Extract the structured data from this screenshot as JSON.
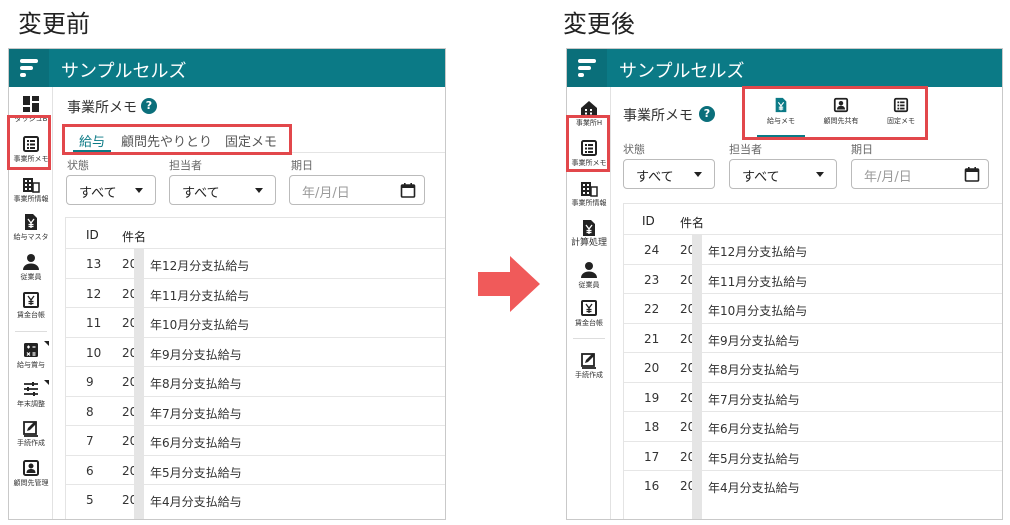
{
  "captions": {
    "before": "変更前",
    "after": "変更後"
  },
  "app": {
    "title": "サンプルセルズ"
  },
  "before": {
    "sidebar": [
      {
        "label": "ダッシュB",
        "icon": "dashboard-icon"
      },
      {
        "label": "事業所メモ",
        "icon": "memo-list-icon"
      },
      {
        "label": "事業所情報",
        "icon": "building-icon"
      },
      {
        "label": "給与マスタ",
        "icon": "yen-file-icon"
      },
      {
        "label": "従業員",
        "icon": "person-icon"
      },
      {
        "label": "賃金台帳",
        "icon": "ledger-icon"
      },
      {
        "label": "給与賞与",
        "icon": "calculator-icon"
      },
      {
        "label": "年末調整",
        "icon": "sliders-icon"
      },
      {
        "label": "手続作成",
        "icon": "edit-doc-icon"
      },
      {
        "label": "顧問先管理",
        "icon": "contact-icon"
      }
    ],
    "page_title": "事業所メモ",
    "tabs": [
      "給与",
      "顧問先やりとり",
      "固定メモ"
    ],
    "filters": {
      "status_label": "状態",
      "status_value": "すべて",
      "assignee_label": "担当者",
      "assignee_value": "すべて",
      "date_label": "期日",
      "date_placeholder": "年/月/日"
    },
    "table": {
      "headers": [
        "ID",
        "件名"
      ],
      "rows": [
        {
          "id": "13",
          "prefix": "20",
          "title": "年12月分支払給与"
        },
        {
          "id": "12",
          "prefix": "20",
          "title": "年11月分支払給与"
        },
        {
          "id": "11",
          "prefix": "20",
          "title": "年10月分支払給与"
        },
        {
          "id": "10",
          "prefix": "20",
          "title": "年9月分支払給与"
        },
        {
          "id": "9",
          "prefix": "20",
          "title": "年8月分支払給与"
        },
        {
          "id": "8",
          "prefix": "20",
          "title": "年7月分支払給与"
        },
        {
          "id": "7",
          "prefix": "20",
          "title": "年6月分支払給与"
        },
        {
          "id": "6",
          "prefix": "20",
          "title": "年5月分支払給与"
        },
        {
          "id": "5",
          "prefix": "20",
          "title": "年4月分支払給与"
        }
      ]
    }
  },
  "after": {
    "sidebar": [
      {
        "label": "事業所H",
        "icon": "home-building-icon"
      },
      {
        "label": "事業所メモ",
        "icon": "memo-list-icon"
      },
      {
        "label": "事業所情報",
        "icon": "building-icon"
      },
      {
        "label": "計算処理",
        "icon": "yen-file-icon"
      },
      {
        "label": "従業員",
        "icon": "person-icon"
      },
      {
        "label": "賃金台帳",
        "icon": "ledger-icon"
      },
      {
        "label": "手続作成",
        "icon": "edit-doc-icon"
      }
    ],
    "page_title": "事業所メモ",
    "tabs": [
      {
        "label": "給与メモ",
        "icon": "yen-file-icon"
      },
      {
        "label": "顧問先共有",
        "icon": "contact-icon"
      },
      {
        "label": "固定メモ",
        "icon": "memo-list-icon"
      }
    ],
    "filters": {
      "status_label": "状態",
      "status_value": "すべて",
      "assignee_label": "担当者",
      "assignee_value": "すべて",
      "date_label": "期日",
      "date_placeholder": "年/月/日"
    },
    "table": {
      "headers": [
        "ID",
        "件名"
      ],
      "rows": [
        {
          "id": "24",
          "prefix": "20",
          "title": "年12月分支払給与"
        },
        {
          "id": "23",
          "prefix": "20",
          "title": "年11月分支払給与"
        },
        {
          "id": "22",
          "prefix": "20",
          "title": "年10月分支払給与"
        },
        {
          "id": "21",
          "prefix": "20",
          "title": "年9月分支払給与"
        },
        {
          "id": "20",
          "prefix": "20",
          "title": "年8月分支払給与"
        },
        {
          "id": "19",
          "prefix": "20",
          "title": "年7月分支払給与"
        },
        {
          "id": "18",
          "prefix": "20",
          "title": "年6月分支払給与"
        },
        {
          "id": "17",
          "prefix": "20",
          "title": "年5月分支払給与"
        },
        {
          "id": "16",
          "prefix": "20",
          "title": "年4月分支払給与"
        }
      ]
    }
  },
  "colors": {
    "brand": "#0b7a86",
    "highlight": "#e2474b",
    "arrow": "#f05a5a"
  }
}
